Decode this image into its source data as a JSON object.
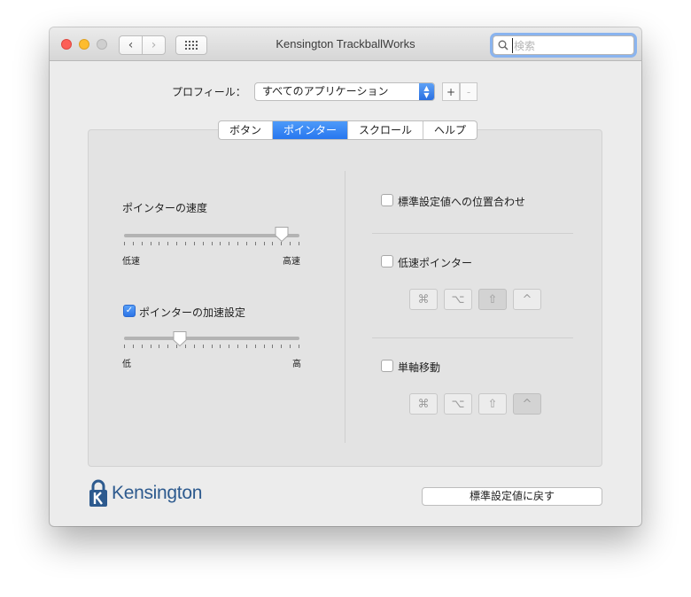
{
  "window": {
    "title": "Kensington TrackballWorks",
    "search_placeholder": "検索"
  },
  "toolbar": {
    "back_icon": "‹",
    "forward_icon": "›",
    "grid_icon": "⋮⋮⋮"
  },
  "profile": {
    "label": "プロフィール：",
    "selected": "すべてのアプリケーション",
    "add_label": "+",
    "remove_label": "-"
  },
  "tabs": [
    {
      "label": "ボタン",
      "active": false
    },
    {
      "label": "ポインター",
      "active": true
    },
    {
      "label": "スクロール",
      "active": false
    },
    {
      "label": "ヘルプ",
      "active": false
    }
  ],
  "left": {
    "speed": {
      "title": "ポインターの速度",
      "min_label": "低速",
      "max_label": "高速",
      "value_percent": 90
    },
    "acceleration": {
      "checkbox_label": "ポインターの加速設定",
      "checked": true,
      "min_label": "低",
      "max_label": "高",
      "value_percent": 32
    }
  },
  "right": {
    "snap_to_default": {
      "label": "標準設定値への位置合わせ",
      "checked": false
    },
    "slow_pointer": {
      "label": "低速ポインター",
      "checked": false,
      "keys": [
        {
          "glyph": "⌘",
          "pressed": false
        },
        {
          "glyph": "⌥",
          "pressed": false
        },
        {
          "glyph": "⇧",
          "pressed": true
        },
        {
          "glyph": "^",
          "pressed": false
        }
      ]
    },
    "single_axis": {
      "label": "単軸移動",
      "checked": false,
      "keys": [
        {
          "glyph": "⌘",
          "pressed": false
        },
        {
          "glyph": "⌥",
          "pressed": false
        },
        {
          "glyph": "⇧",
          "pressed": false
        },
        {
          "glyph": "^",
          "pressed": true
        }
      ]
    }
  },
  "footer": {
    "brand": "Kensington",
    "reset_label": "標準設定値に戻す"
  },
  "colors": {
    "accent": "#2877ef",
    "brand": "#2d5a8e"
  }
}
